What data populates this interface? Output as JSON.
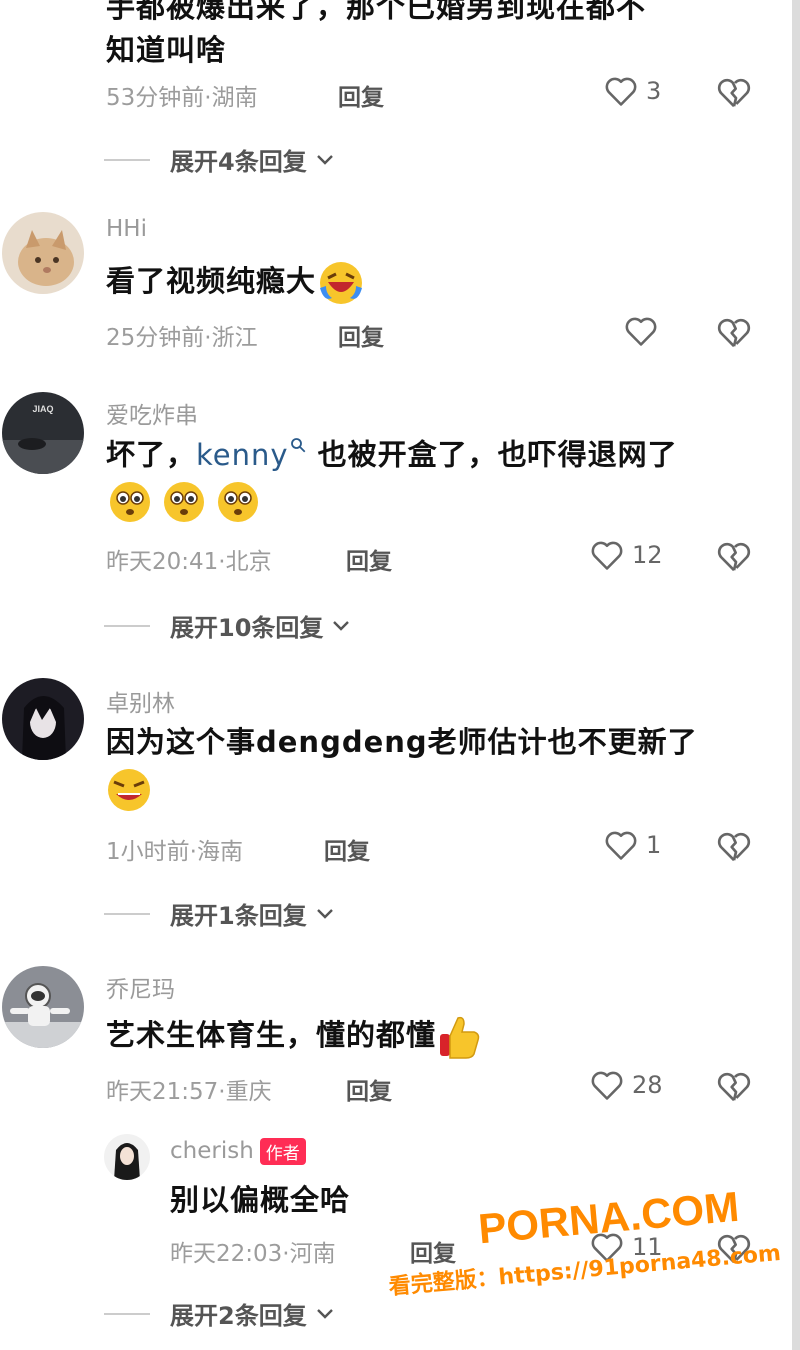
{
  "comments": {
    "c0": {
      "text_line1_partial": "手都被爆出来了，那个已婚男到现在都不",
      "text_line2": "知道叫啥",
      "meta": "53分钟前·湖南",
      "reply_label": "回复",
      "likes": "3",
      "expand": "展开4条回复"
    },
    "c1": {
      "username": "HHi",
      "text": "看了视频纯瘾大",
      "meta": "25分钟前·浙江",
      "reply_label": "回复"
    },
    "c2": {
      "username": "爱吃炸串",
      "avatar_text": "JIAQ",
      "text_pre": "坏了，",
      "mention": "kenny",
      "text_post": " 也被开盒了，也吓得退网了",
      "meta": "昨天20:41·北京",
      "reply_label": "回复",
      "likes": "12",
      "expand": "展开10条回复"
    },
    "c3": {
      "username": "卓别林",
      "text": "因为这个事dengdeng老师估计也不更新了",
      "meta": "1小时前·海南",
      "reply_label": "回复",
      "likes": "1",
      "expand": "展开1条回复"
    },
    "c4": {
      "username": "乔尼玛",
      "text": "艺术生体育生，懂的都懂",
      "meta": "昨天21:57·重庆",
      "reply_label": "回复",
      "likes": "28"
    },
    "r1": {
      "username": "cherish",
      "author_tag": "作者",
      "text": "别以偏概全哈",
      "meta": "昨天22:03·河南",
      "reply_label": "回复",
      "likes": "11",
      "expand": "展开2条回复"
    }
  },
  "watermark": {
    "logo": "PORNA.COM",
    "url_line": "看完整版：https://91porna48.com"
  },
  "colors": {
    "accent_red": "#ff2d55",
    "muted_text": "#9c9c9c",
    "watermark": "#ff8a00"
  },
  "icons": {
    "like": "heart-outline-icon",
    "dislike": "broken-heart-icon",
    "expand": "chevron-down-icon",
    "search": "search-icon"
  }
}
